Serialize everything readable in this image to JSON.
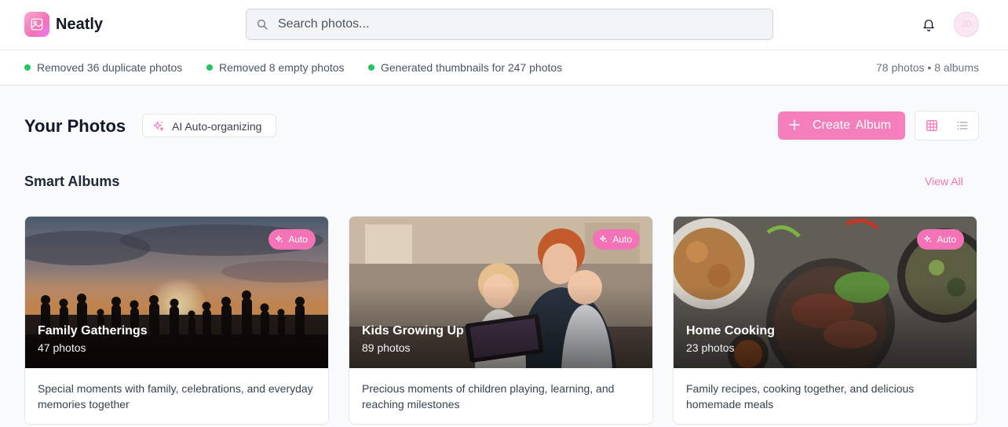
{
  "app": {
    "name": "Neatly",
    "avatar_initials": "JD"
  },
  "search": {
    "placeholder": "Search photos..."
  },
  "status": {
    "items": [
      "Removed 36 duplicate photos",
      "Removed 8 empty photos",
      "Generated thumbnails for 247 photos"
    ],
    "counts": "78 photos • 8 albums"
  },
  "header": {
    "title": "Your Photos",
    "ai_badge": "AI Auto-organizing",
    "create_label": "Create Album"
  },
  "smart_albums": {
    "title": "Smart Albums",
    "view_all": "View All",
    "albums": [
      {
        "title": "Family Gatherings",
        "count": "47 photos",
        "badge": "Auto",
        "description": "Special moments with family, celebrations, and everyday memories together"
      },
      {
        "title": "Kids Growing Up",
        "count": "89 photos",
        "badge": "Auto",
        "description": "Precious moments of children playing, learning, and reaching milestones"
      },
      {
        "title": "Home Cooking",
        "count": "23 photos",
        "badge": "Auto",
        "description": "Family recipes, cooking together, and delicious homemade meals"
      }
    ]
  },
  "colors": {
    "accent": "#f472b6",
    "status_dot": "#22c55e"
  }
}
